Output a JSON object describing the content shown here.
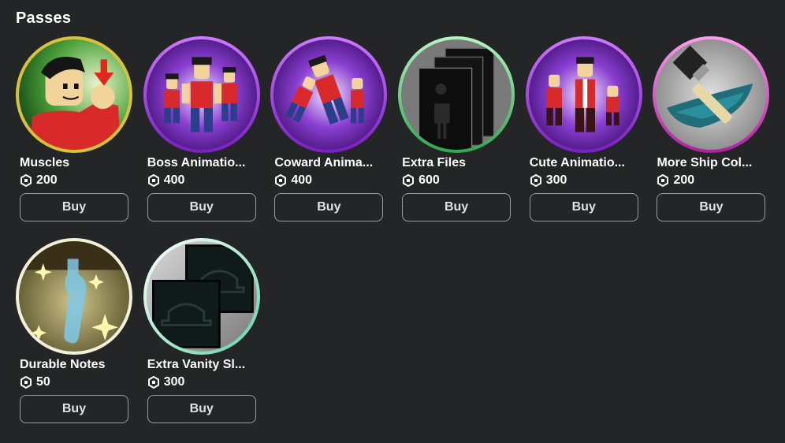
{
  "section": {
    "title": "Passes"
  },
  "currency": {
    "icon": "robux-icon"
  },
  "passes": [
    {
      "name": "Muscles",
      "price": "200",
      "button": "Buy",
      "ring": "#d9c23a",
      "icon": "muscles-pass-icon"
    },
    {
      "name": "Boss Animatio...",
      "price": "400",
      "button": "Buy",
      "ring": "#8b2fc9",
      "icon": "boss-animations-pass-icon"
    },
    {
      "name": "Coward Anima...",
      "price": "400",
      "button": "Buy",
      "ring": "#8b2fc9",
      "icon": "coward-animations-pass-icon"
    },
    {
      "name": "Extra Files",
      "price": "600",
      "button": "Buy",
      "ring": "#3fc26a",
      "icon": "extra-files-pass-icon"
    },
    {
      "name": "Cute Animatio...",
      "price": "300",
      "button": "Buy",
      "ring": "#8b2fc9",
      "icon": "cute-animations-pass-icon"
    },
    {
      "name": "More Ship Col...",
      "price": "200",
      "button": "Buy",
      "ring": "#c02fb3",
      "icon": "ship-colors-pass-icon"
    },
    {
      "name": "Durable Notes",
      "price": "50",
      "button": "Buy",
      "ring": "#f2f0d8",
      "icon": "durable-notes-pass-icon"
    },
    {
      "name": "Extra Vanity Sl...",
      "price": "300",
      "button": "Buy",
      "ring": "#6fe0b8",
      "icon": "extra-vanity-pass-icon"
    }
  ]
}
